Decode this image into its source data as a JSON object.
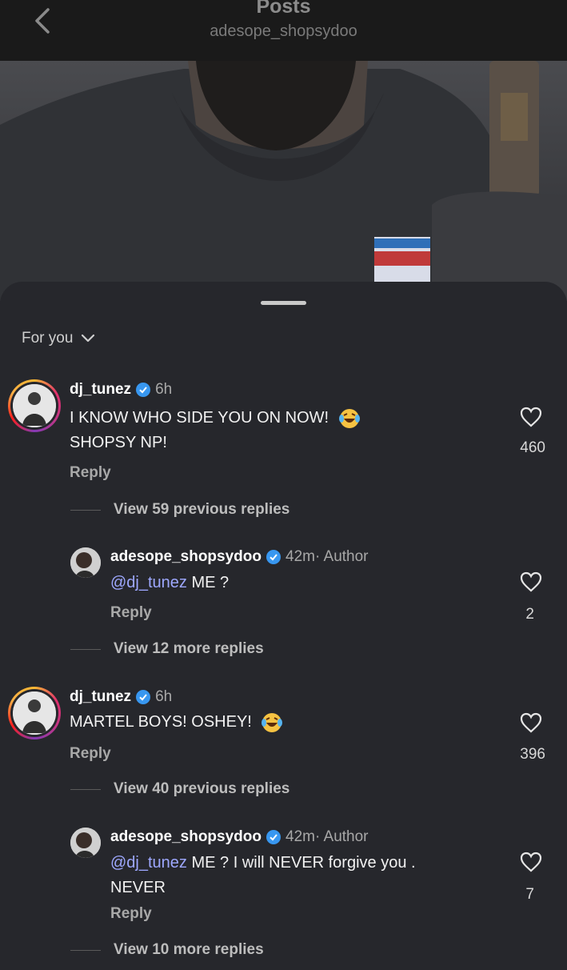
{
  "header": {
    "title": "Posts",
    "subtitle": "adesope_shopsydoo"
  },
  "filter": {
    "label": "For you"
  },
  "comments": [
    {
      "username": "dj_tunez",
      "time": "6h",
      "text_line1": "I KNOW WHO SIDE YOU ON NOW!",
      "text_line2": "SHOPSY NP!",
      "reply_label": "Reply",
      "likes": "460",
      "view_label": "View 59 previous replies"
    },
    {
      "username": "adesope_shopsydoo",
      "time": "42m",
      "author_tag": " · Author",
      "mention": "@dj_tunez",
      "text": " ME ?",
      "reply_label": "Reply",
      "likes": "2",
      "view_label": "View 12 more replies"
    },
    {
      "username": "dj_tunez",
      "time": "6h",
      "text": "MARTEL BOYS! OSHEY!",
      "reply_label": "Reply",
      "likes": "396",
      "view_label": "View 40 previous replies"
    },
    {
      "username": "adesope_shopsydoo",
      "time": "42m",
      "author_tag": " · Author",
      "mention": "@dj_tunez",
      "text": " ME ? I will NEVER forgive you .",
      "text_line2": "NEVER",
      "reply_label": "Reply",
      "likes": "7",
      "view_label": "View 10 more replies"
    }
  ],
  "colors": {
    "background": "#26272c",
    "verified": "#3897f0",
    "mention": "#9ea8ff"
  }
}
